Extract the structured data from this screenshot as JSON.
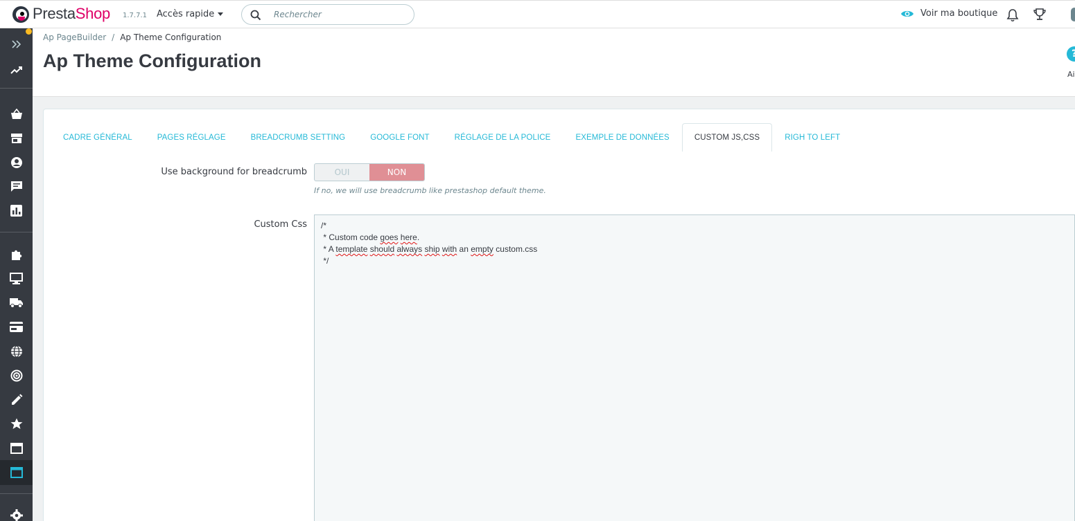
{
  "header": {
    "brand_main": "Presta",
    "brand_accent": "Shop",
    "version": "1.7.7.1",
    "quick_access": "Accès rapide",
    "search_placeholder": "Rechercher",
    "view_shop": "Voir ma boutique"
  },
  "page": {
    "breadcrumb": [
      "Ap PageBuilder",
      "Ap Theme Configuration"
    ],
    "breadcrumb_separator": "/",
    "title": "Ap Theme Configuration",
    "help_icon_glyph": "?",
    "help_label": "Ai"
  },
  "sidebar": {
    "items": [
      {
        "icon": "expand-icon"
      },
      {
        "icon": "dashboard-trend-icon"
      },
      {
        "icon": "orders-basket-icon"
      },
      {
        "icon": "catalog-store-icon"
      },
      {
        "icon": "customers-icon"
      },
      {
        "icon": "customer-service-icon"
      },
      {
        "icon": "stats-icon"
      },
      {
        "icon": "modules-puzzle-icon"
      },
      {
        "icon": "design-monitor-icon"
      },
      {
        "icon": "shipping-truck-icon"
      },
      {
        "icon": "payment-card-icon"
      },
      {
        "icon": "international-globe-icon"
      },
      {
        "icon": "marketing-target-icon"
      },
      {
        "icon": "edit-pencil-icon"
      },
      {
        "icon": "favorites-star-icon"
      },
      {
        "icon": "window-icon"
      },
      {
        "icon": "pagebuilder-window-icon"
      },
      {
        "icon": "settings-gear-icon"
      }
    ],
    "active_color": "#25b9d7"
  },
  "tabs": [
    {
      "label": "CADRE GÉNÉRAL",
      "active": false
    },
    {
      "label": "PAGES RÉGLAGE",
      "active": false
    },
    {
      "label": "BREADCRUMB SETTING",
      "active": false
    },
    {
      "label": "GOOGLE FONT",
      "active": false
    },
    {
      "label": "RÉGLAGE DE LA POLICE",
      "active": false
    },
    {
      "label": "EXEMPLE DE DONNÉES",
      "active": false
    },
    {
      "label": "CUSTOM JS,CSS",
      "active": true
    },
    {
      "label": "RIGH TO LEFT",
      "active": false
    }
  ],
  "form": {
    "breadcrumb_bg_label": "Use background for breadcrumb",
    "switch_yes": "OUI",
    "switch_no": "NON",
    "switch_value": "NON",
    "breadcrumb_help": "If no, we will use breadcrumb like prestashop default theme.",
    "custom_css_label": "Custom Css",
    "custom_css_lines": [
      "/*",
      " * Custom code goes here.",
      " * A template should always ship with an empty custom.css",
      " */"
    ]
  },
  "colors": {
    "accent": "#25b9d7",
    "brand_pink": "#df0067",
    "sidebar_bg": "#363a41",
    "switch_off": "#e08f95"
  }
}
